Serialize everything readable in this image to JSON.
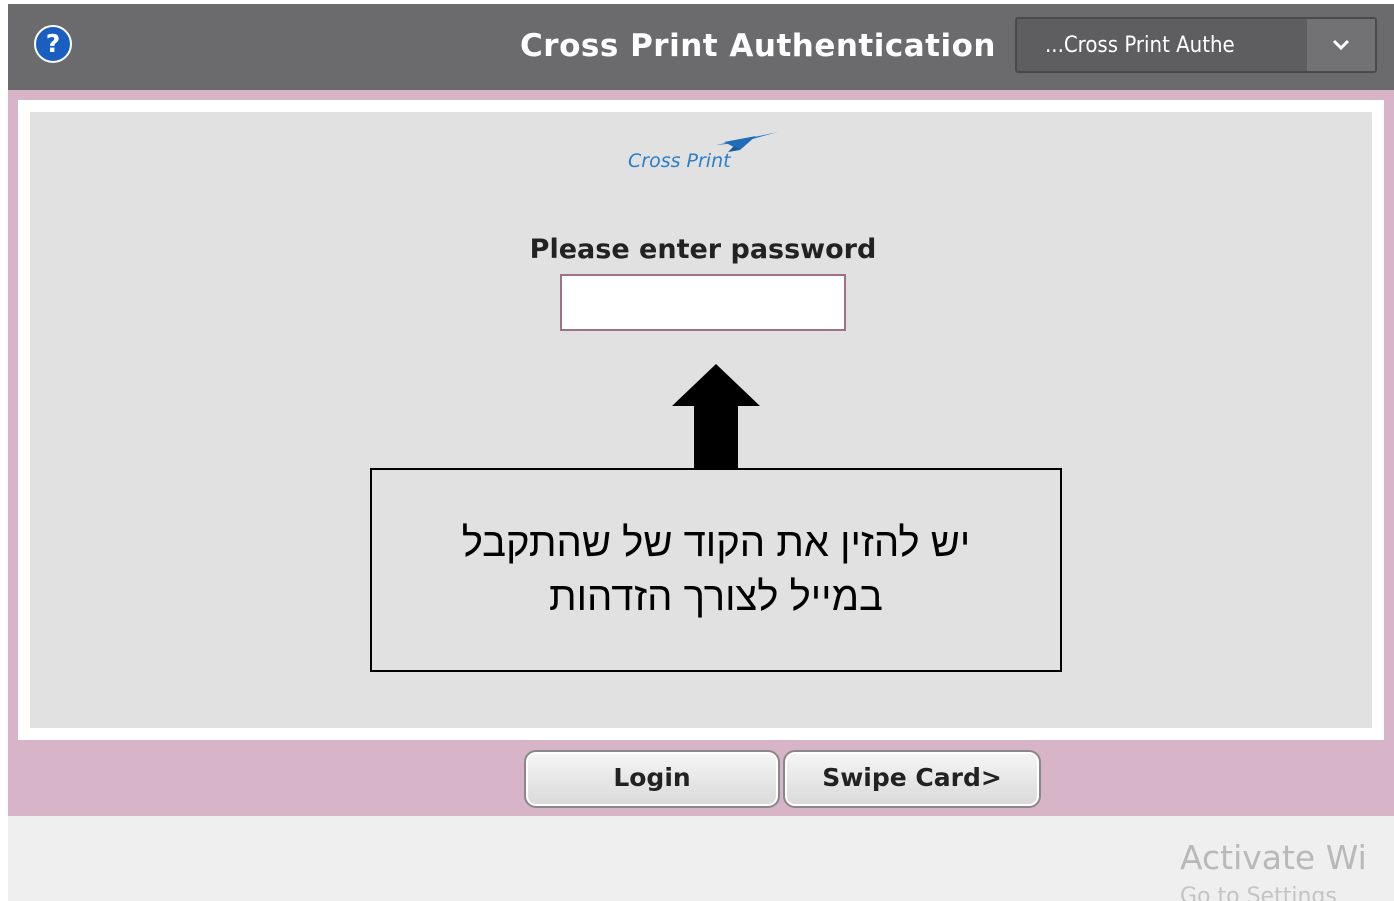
{
  "window": {
    "title": "Cross Print Authentication",
    "help_icon": "question-mark-icon",
    "help_glyph": "?",
    "selector": {
      "value": "...Cross Print Authe",
      "arrow_icon": "chevron-down-icon"
    }
  },
  "logo": {
    "text": "Cross Print",
    "icon": "paper-plane-icon",
    "color": "#2a7fc9"
  },
  "form": {
    "prompt": "Please enter password",
    "password_value": ""
  },
  "annotation": {
    "arrow_icon": "arrow-up-icon",
    "line1": "יש להזין את הקוד של שהתקבל",
    "line2": "במייל לצורך הזדהות"
  },
  "buttons": {
    "login": "Login",
    "swipe_card": "Swipe Card>"
  },
  "watermark": {
    "line1": "Activate Wi",
    "line2": "Go to Settings"
  },
  "colors": {
    "titlebar": "#6b6b6d",
    "body_border": "#d8b4c8",
    "help_icon": "#1a5fc0"
  }
}
